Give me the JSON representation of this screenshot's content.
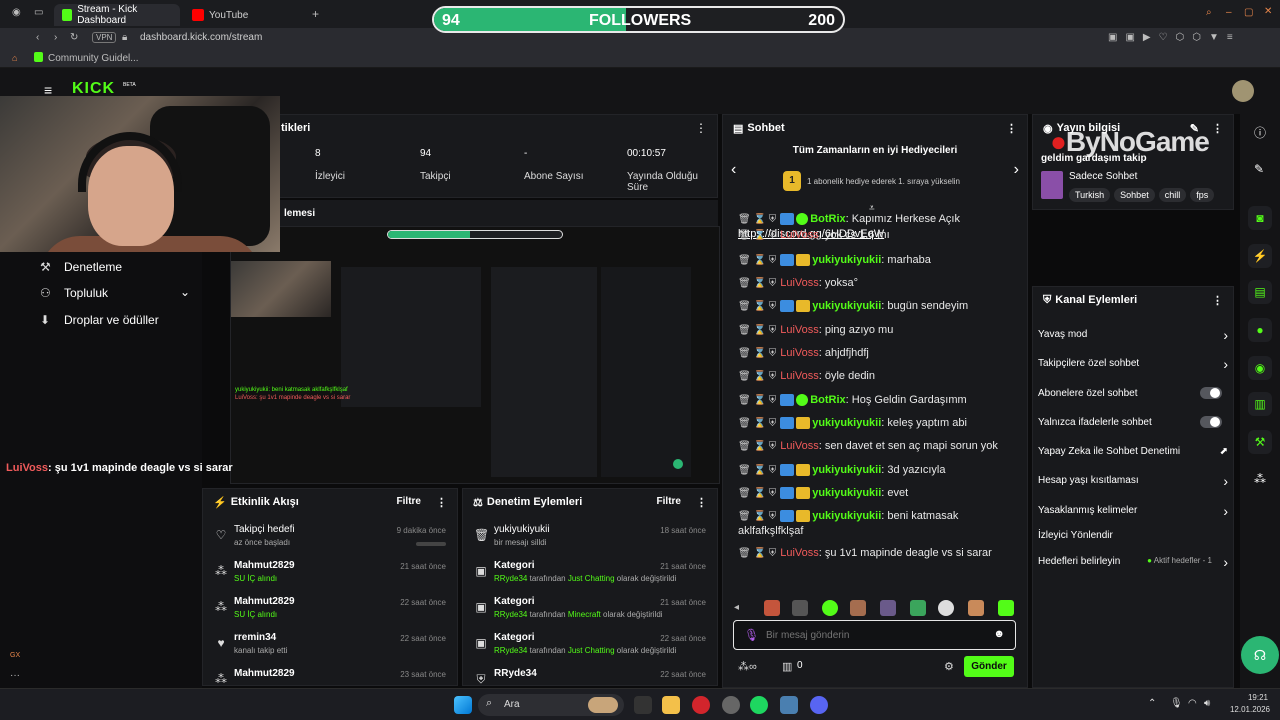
{
  "browser": {
    "tabs": [
      {
        "label": "Stream - Kick Dashboard",
        "color": "#53fc18"
      },
      {
        "label": "YouTube",
        "color": "#ff0000"
      }
    ],
    "vpn_label": "VPN",
    "url": "dashboard.kick.com/stream",
    "bookmark": "Community Guidel..."
  },
  "followers_bar": {
    "current": "94",
    "label": "FOLLOWERS",
    "goal": "200",
    "progress": 0.47
  },
  "logo": {
    "text": "KICK",
    "beta": "BETA"
  },
  "left_nav": {
    "items": [
      {
        "label": "Denetleme"
      },
      {
        "label": "Topluluk"
      },
      {
        "label": "Droplar ve ödüller"
      }
    ]
  },
  "stats": {
    "header": "tikleri",
    "items": [
      {
        "value": "8",
        "label": "İzleyici"
      },
      {
        "value": "94",
        "label": "Takipçi"
      },
      {
        "value": "-",
        "label": "Abone Sayısı"
      },
      {
        "value": "00:10:57",
        "label": "Yayında Olduğu Süre"
      }
    ]
  },
  "preview": {
    "header": "lemesi"
  },
  "overlay_chat": {
    "user": "LuiVoss",
    "text": ": şu 1v1 mapinde deagle vs si sarar"
  },
  "gx_label": "GX",
  "activity": {
    "title": "Etkinlik Akışı",
    "filter": "Filtre",
    "items": [
      {
        "title": "Takipçi hedefi",
        "sub": "az önce başladı",
        "time": "9 dakika önce"
      },
      {
        "title": "Mahmut2829",
        "sub": "SU İÇ alındı",
        "time": "21 saat önce"
      },
      {
        "title": "Mahmut2829",
        "sub": "SU İÇ alındı",
        "time": "22 saat önce"
      },
      {
        "title": "rremin34",
        "sub": "kanalı takip etti",
        "time": "22 saat önce"
      },
      {
        "title": "Mahmut2829",
        "sub": "",
        "time": "23 saat önce"
      }
    ]
  },
  "moderation": {
    "title": "Denetim Eylemleri",
    "filter": "Filtre",
    "items": [
      {
        "title": "yukiyukiyukii",
        "sub": "bir mesajı silldi",
        "time": "18 saat önce"
      },
      {
        "title": "Kategori",
        "sub_user": "RRyde34",
        "sub_mid": "tarafından",
        "sub_cat": "Just Chatting",
        "sub_end": "olarak değiştirildi",
        "time": "21 saat önce"
      },
      {
        "title": "Kategori",
        "sub_user": "RRyde34",
        "sub_mid": "tarafından",
        "sub_cat": "Minecraft",
        "sub_end": "olarak değiştirildi",
        "time": "21 saat önce"
      },
      {
        "title": "Kategori",
        "sub_user": "RRyde34",
        "sub_mid": "tarafından",
        "sub_cat": "Just Chatting",
        "sub_end": "olarak değiştirildi",
        "time": "22 saat önce"
      },
      {
        "title": "RRyde34",
        "time": "22 saat önce"
      }
    ]
  },
  "chat": {
    "title": "Sohbet",
    "gifters_title": "Tüm Zamanların en iyi Hediyecileri",
    "gifters_rank": "1",
    "gifters_text": "1 abonelik hediye ederek 1. sıraya yükselin",
    "messages": [
      {
        "user": "BotRix",
        "cls": "nm-green",
        "badges": [
          "blue",
          "green"
        ],
        "text": ": Kapımız Herkese Açık",
        "link": "https://discord.gg/6HDDvEqW"
      },
      {
        "user": "LuiVoss",
        "cls": "nm-red",
        "badges": [],
        "text": ": yok cs 1.6 mı"
      },
      {
        "user": "yukiyukiyukii",
        "cls": "nm-green",
        "badges": [
          "blue",
          "gold"
        ],
        "text": ": marhaba"
      },
      {
        "user": "LuiVoss",
        "cls": "nm-red",
        "badges": [],
        "text": ": yoksa°"
      },
      {
        "user": "yukiyukiyukii",
        "cls": "nm-green",
        "badges": [
          "blue",
          "gold"
        ],
        "text": ": bugün sendeyim"
      },
      {
        "user": "LuiVoss",
        "cls": "nm-red",
        "badges": [],
        "text": ": ping azıyo mu"
      },
      {
        "user": "LuiVoss",
        "cls": "nm-red",
        "badges": [],
        "text": ": ahjdfjhdfj"
      },
      {
        "user": "LuiVoss",
        "cls": "nm-red",
        "badges": [],
        "text": ": öyle dedin"
      },
      {
        "user": "BotRix",
        "cls": "nm-green",
        "badges": [
          "blue",
          "green"
        ],
        "text": ": Hoş Geldin Gardaşımm"
      },
      {
        "user": "yukiyukiyukii",
        "cls": "nm-green",
        "badges": [
          "blue",
          "gold"
        ],
        "text": ": keleş yaptım abi"
      },
      {
        "user": "LuiVoss",
        "cls": "nm-red",
        "badges": [],
        "text": ": sen davet et sen aç mapi sorun yok"
      },
      {
        "user": "yukiyukiyukii",
        "cls": "nm-green",
        "badges": [
          "blue",
          "gold"
        ],
        "text": ": 3d yazıcıyla"
      },
      {
        "user": "yukiyukiyukii",
        "cls": "nm-green",
        "badges": [
          "blue",
          "gold"
        ],
        "text": ": evet"
      },
      {
        "user": "yukiyukiyukii",
        "cls": "nm-green",
        "badges": [
          "blue",
          "gold"
        ],
        "text": ": beni katmasak aklfafkşlfklşaf"
      },
      {
        "user": "LuiVoss",
        "cls": "nm-red",
        "badges": [],
        "text": ": şu 1v1 mapinde deagle vs si sarar"
      }
    ],
    "input_placeholder": "Bir mesaj gönderin",
    "send_label": "Gönder",
    "points": "0"
  },
  "stream_info": {
    "title": "Yayın bilgisi",
    "stream_title": "geldim gardaşım takip",
    "mode": "Sadece Sohbet",
    "tags": [
      "Turkish",
      "Sohbet",
      "chill",
      "fps"
    ]
  },
  "watermark": "ByNoGame",
  "channel_actions": {
    "title": "Kanal Eylemleri",
    "items": [
      {
        "label": "Yavaş mod",
        "kind": "chevron"
      },
      {
        "label": "Takipçilere özel sohbet",
        "kind": "chevron"
      },
      {
        "label": "Abonelere özel sohbet",
        "kind": "toggle"
      },
      {
        "label": "Yalnızca ifadelerle sohbet",
        "kind": "toggle"
      },
      {
        "label": "Yapay Zeka ile Sohbet Denetimi",
        "kind": "external"
      },
      {
        "label": "Hesap yaşı kısıtlaması",
        "kind": "chevron"
      },
      {
        "label": "Yasaklanmış kelimeler",
        "kind": "chevron"
      },
      {
        "label": "İzleyici Yönlendir",
        "kind": "none"
      },
      {
        "label": "Hedefleri belirleyin",
        "kind": "chevron"
      }
    ],
    "active_goals": "Aktif hedefler - 1"
  },
  "taskbar": {
    "search": "Ara",
    "time": "19:21",
    "date": "12.01.2026"
  }
}
